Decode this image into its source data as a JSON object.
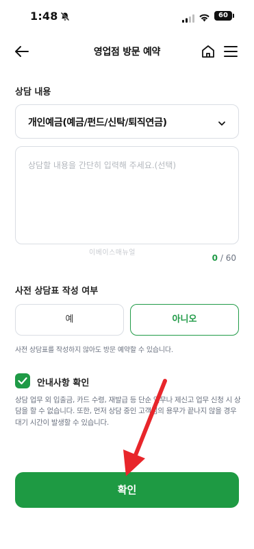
{
  "status_bar": {
    "time": "1:48",
    "battery": "60"
  },
  "header": {
    "title": "영업점 방문 예약"
  },
  "consult": {
    "section_label": "상담 내용",
    "selected_option": "개인예금(예금/펀드/신탁/퇴직연금)",
    "placeholder": "상담할 내용을 간단히 입력해 주세요.(선택)",
    "char_count": "0",
    "char_max": "/ 60",
    "watermark": "이베이스매뉴얼"
  },
  "pre_form": {
    "section_label": "사전 상담표 작성 여부",
    "yes_label": "예",
    "no_label": "아니오",
    "selected": "아니오",
    "helper_text": "사전 상담표를 작성하지 않아도 방문 예약할 수 있습니다."
  },
  "notice": {
    "checkbox_label": "안내사항 확인",
    "checked": true,
    "text": "상담 업무 외 입출금, 카드 수령, 재발급 등 단순 업무나 제신고 업무 신청 시 상담을 할 수 없습니다. 또한, 먼저 상담 중인 고객님의 용무가 끝나지 않을 경우 대기 시간이 발생할 수 있습니다."
  },
  "confirm_button": {
    "label": "확인"
  },
  "colors": {
    "accent": "#1e9a43",
    "annotation_arrow": "#e8262b"
  },
  "icons": [
    "bell-off-icon",
    "signal-icon",
    "wifi-icon",
    "battery-icon",
    "back-arrow-icon",
    "home-icon",
    "menu-icon",
    "chevron-down-icon",
    "check-icon"
  ]
}
